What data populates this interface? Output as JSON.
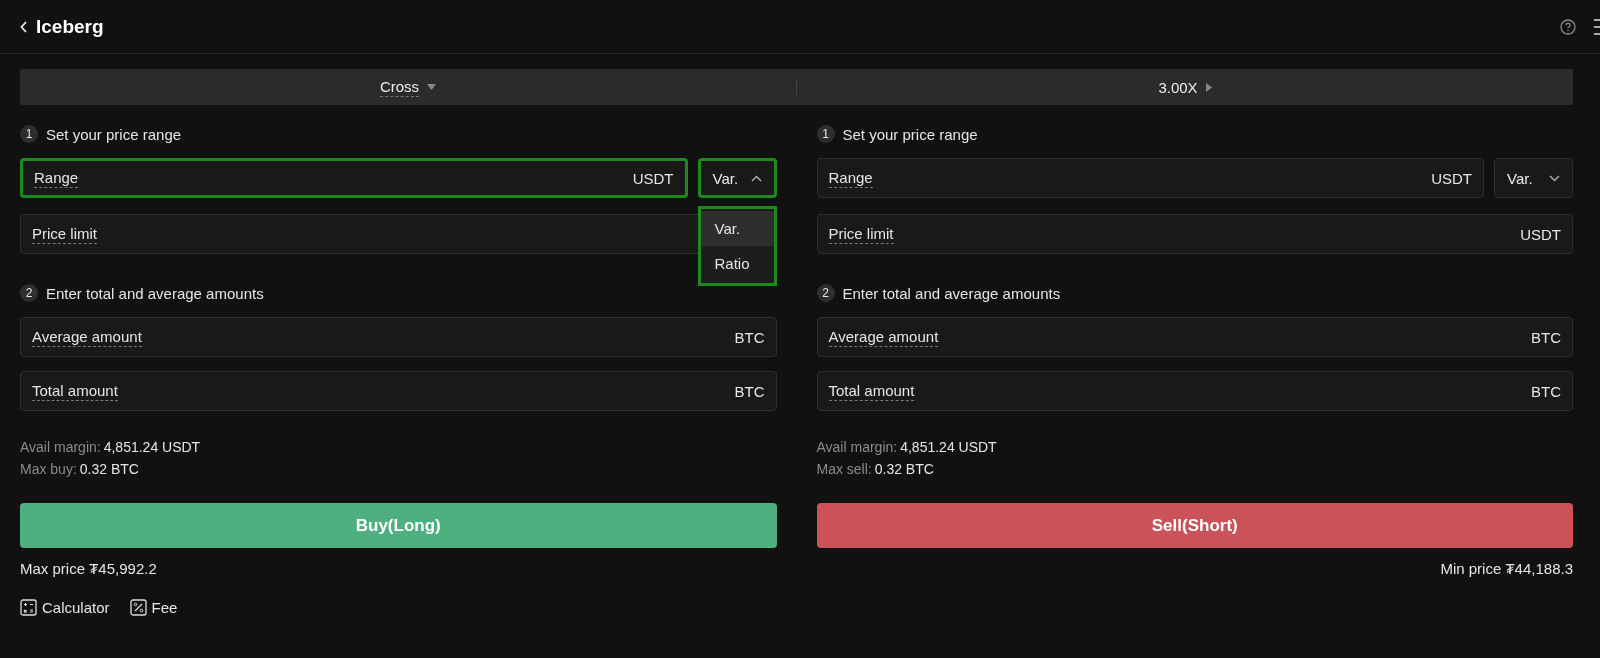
{
  "header": {
    "title": "Iceberg"
  },
  "mode_bar": [
    {
      "label": "Cross",
      "kind": "dropdown"
    },
    {
      "label": "3.00X",
      "kind": "link"
    }
  ],
  "panels": [
    {
      "step1": {
        "number": "1",
        "label": "Set your price range"
      },
      "range_field": {
        "label": "Range",
        "unit": "USDT",
        "highlighted": true
      },
      "type_select": {
        "value": "Var.",
        "expanded": true,
        "highlighted": true,
        "options": [
          {
            "label": "Var.",
            "selected": true
          },
          {
            "label": "Ratio",
            "selected": false
          }
        ]
      },
      "price_limit": {
        "label": "Price limit"
      },
      "step2": {
        "number": "2",
        "label": "Enter total and average amounts"
      },
      "amount_fields": [
        {
          "label": "Average amount",
          "unit": "BTC"
        },
        {
          "label": "Total amount",
          "unit": "BTC"
        }
      ],
      "info": [
        {
          "label": "Avail margin:",
          "value": "4,851.24 USDT"
        },
        {
          "label": "Max buy:",
          "value": "0.32 BTC"
        }
      ],
      "action": {
        "label": "Buy(Long)",
        "kind": "buy"
      },
      "price_note": "Max price ₮45,992.2"
    },
    {
      "step1": {
        "number": "1",
        "label": "Set your price range"
      },
      "range_field": {
        "label": "Range",
        "unit": "USDT",
        "highlighted": false
      },
      "type_select": {
        "value": "Var.",
        "expanded": false,
        "highlighted": false
      },
      "price_limit": {
        "label": "Price limit",
        "unit": "USDT"
      },
      "step2": {
        "number": "2",
        "label": "Enter total and average amounts"
      },
      "amount_fields": [
        {
          "label": "Average amount",
          "unit": "BTC"
        },
        {
          "label": "Total amount",
          "unit": "BTC"
        }
      ],
      "info": [
        {
          "label": "Avail margin:",
          "value": "4,851.24 USDT"
        },
        {
          "label": "Max sell:",
          "value": "0.32 BTC"
        }
      ],
      "action": {
        "label": "Sell(Short)",
        "kind": "sell"
      },
      "price_note": "Min price ₮44,188.3"
    }
  ],
  "tools": [
    {
      "label": "Calculator",
      "kind": "calculator"
    },
    {
      "label": "Fee",
      "kind": "fee"
    }
  ]
}
